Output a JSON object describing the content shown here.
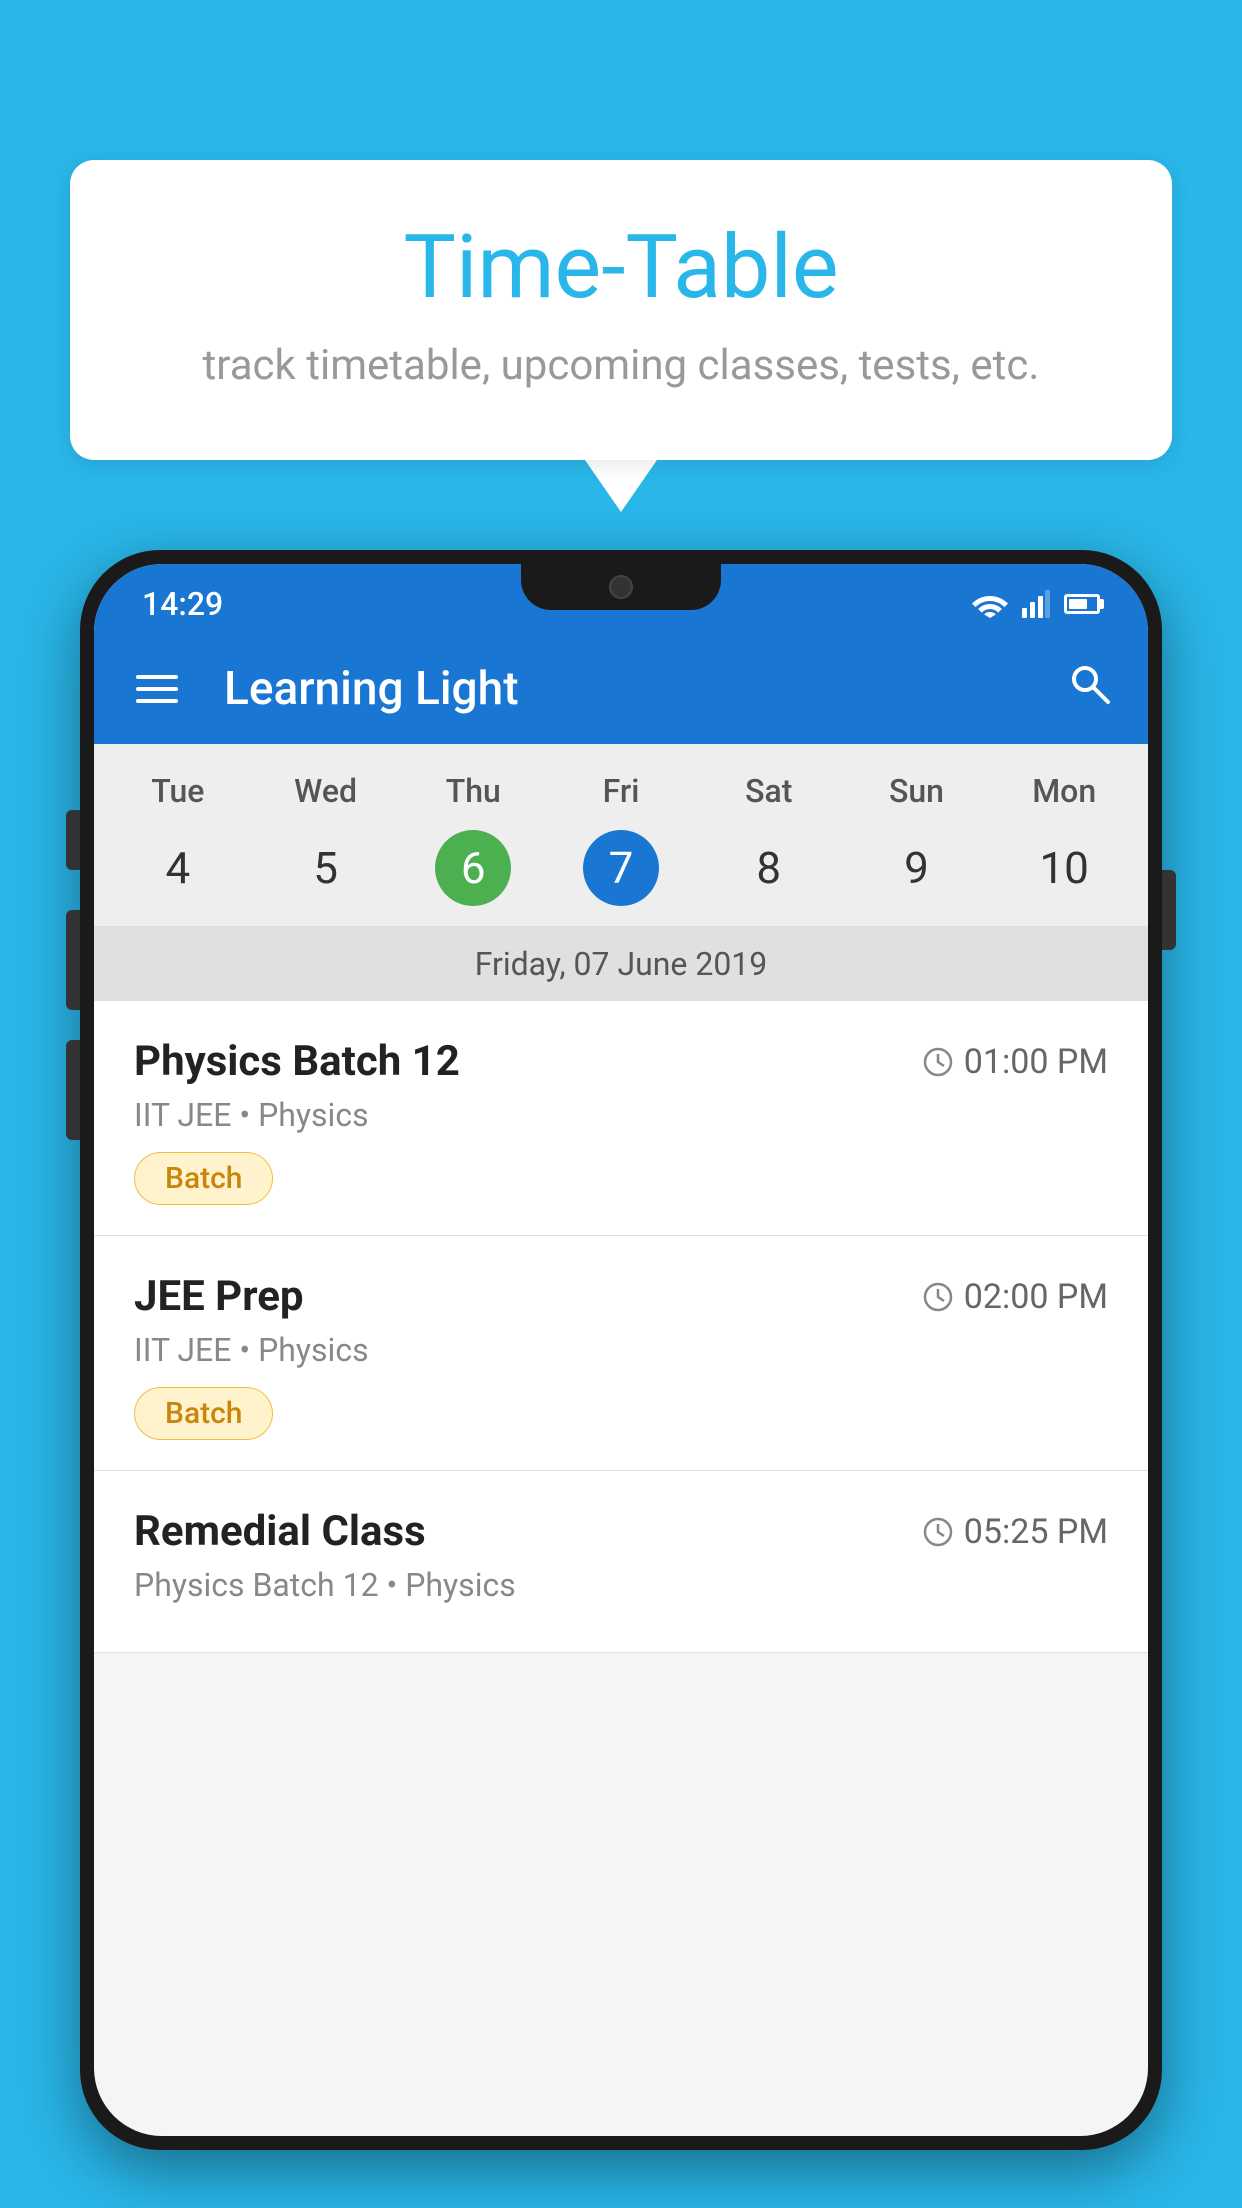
{
  "background_color": "#29B6E8",
  "speech_bubble": {
    "title": "Time-Table",
    "subtitle": "track timetable, upcoming classes, tests, etc."
  },
  "phone": {
    "status_bar": {
      "time": "14:29"
    },
    "app_bar": {
      "title": "Learning Light"
    },
    "calendar": {
      "day_headers": [
        "Tue",
        "Wed",
        "Thu",
        "Fri",
        "Sat",
        "Sun",
        "Mon"
      ],
      "day_numbers": [
        "4",
        "5",
        "6",
        "7",
        "8",
        "9",
        "10"
      ],
      "today_index": 2,
      "selected_index": 3,
      "selected_date_label": "Friday, 07 June 2019"
    },
    "classes": [
      {
        "name": "Physics Batch 12",
        "time": "01:00 PM",
        "subject": "IIT JEE • Physics",
        "tag": "Batch"
      },
      {
        "name": "JEE Prep",
        "time": "02:00 PM",
        "subject": "IIT JEE • Physics",
        "tag": "Batch"
      },
      {
        "name": "Remedial Class",
        "time": "05:25 PM",
        "subject": "Physics Batch 12 • Physics",
        "tag": ""
      }
    ]
  }
}
